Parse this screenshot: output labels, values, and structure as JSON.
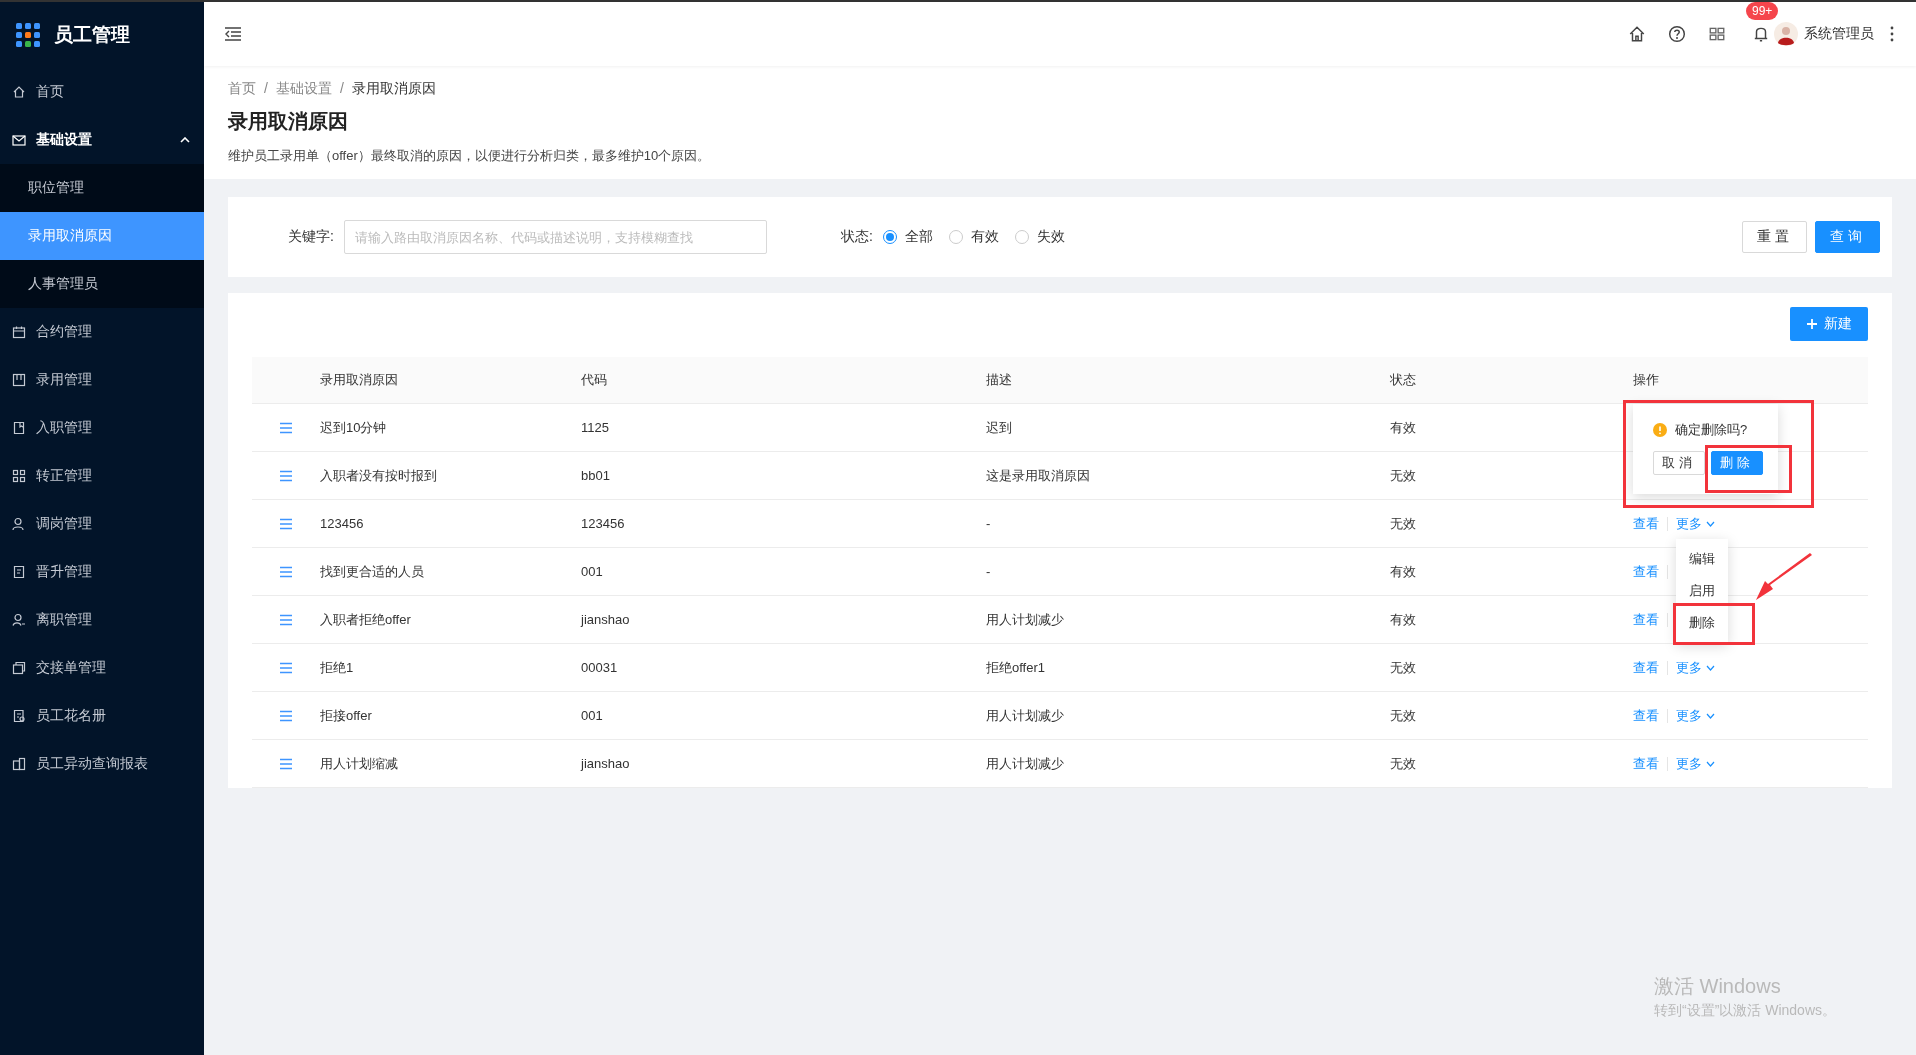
{
  "app": {
    "title": "员工管理"
  },
  "sidebar": {
    "items": [
      {
        "label": "首页"
      },
      {
        "label": "基础设置",
        "expanded": true,
        "children": [
          {
            "label": "职位管理",
            "selected": false
          },
          {
            "label": "录用取消原因",
            "selected": true
          },
          {
            "label": "人事管理员",
            "selected": false
          }
        ]
      },
      {
        "label": "合约管理"
      },
      {
        "label": "录用管理"
      },
      {
        "label": "入职管理"
      },
      {
        "label": "转正管理"
      },
      {
        "label": "调岗管理"
      },
      {
        "label": "晋升管理"
      },
      {
        "label": "离职管理"
      },
      {
        "label": "交接单管理"
      },
      {
        "label": "员工花名册"
      },
      {
        "label": "员工异动查询报表"
      }
    ]
  },
  "header": {
    "notification_badge": "99+",
    "user_name": "系统管理员"
  },
  "breadcrumb": {
    "separator": "/",
    "items": [
      "首页",
      "基础设置",
      "录用取消原因"
    ]
  },
  "page": {
    "title": "录用取消原因",
    "description": "维护员工录用单（offer）最终取消的原因，以便进行分析归类，最多维护10个原因。"
  },
  "filter": {
    "keyword_label": "关键字:",
    "keyword_placeholder": "请输入路由取消原因名称、代码或描述说明，支持模糊查找",
    "status_label": "状态:",
    "status_options": [
      {
        "label": "全部",
        "selected": true
      },
      {
        "label": "有效",
        "selected": false
      },
      {
        "label": "失效",
        "selected": false
      }
    ],
    "buttons": [
      {
        "label": "重置",
        "kind": "default"
      },
      {
        "label": "查询",
        "kind": "primary"
      }
    ]
  },
  "new_button": {
    "label": "新建"
  },
  "table": {
    "columns": [
      "录用取消原因",
      "代码",
      "描述",
      "状态",
      "操作"
    ],
    "rows": [
      {
        "reason": "迟到10分钟",
        "code": "1125",
        "description": "迟到",
        "status": "有效",
        "menu_open": false
      },
      {
        "reason": "入职者没有按时报到",
        "code": "bb01",
        "description": "这是录用取消原因",
        "status": "无效",
        "menu_open": false
      },
      {
        "reason": "123456",
        "code": "123456",
        "description": "-",
        "status": "无效",
        "menu_open": true,
        "actions": [
          {
            "label": "查看",
            "kind": "link"
          },
          {
            "label": "更多",
            "kind": "dropdown"
          }
        ]
      },
      {
        "reason": "找到更合适的人员",
        "code": "001",
        "description": "-",
        "status": "有效",
        "menu_open": false,
        "actions": [
          {
            "label": "查看",
            "kind": "link"
          }
        ]
      },
      {
        "reason": "入职者拒绝offer",
        "code": "jianshao",
        "description": "用人计划减少",
        "status": "有效",
        "menu_open": false,
        "actions": [
          {
            "label": "查看",
            "kind": "link"
          }
        ]
      },
      {
        "reason": "拒绝1",
        "code": "00031",
        "description": "拒绝offer1",
        "status": "无效",
        "menu_open": false,
        "actions": [
          {
            "label": "查看",
            "kind": "link"
          },
          {
            "label": "更多",
            "kind": "dropdown"
          }
        ]
      },
      {
        "reason": "拒接offer",
        "code": "001",
        "description": "用人计划减少",
        "status": "无效",
        "menu_open": false,
        "actions": [
          {
            "label": "查看",
            "kind": "link"
          },
          {
            "label": "更多",
            "kind": "dropdown"
          }
        ]
      },
      {
        "reason": "用人计划缩减",
        "code": "jianshao",
        "description": "用人计划减少",
        "status": "无效",
        "menu_open": false,
        "actions": [
          {
            "label": "查看",
            "kind": "link"
          },
          {
            "label": "更多",
            "kind": "dropdown"
          }
        ]
      }
    ]
  },
  "dropdown_menu": {
    "pointer_arrow": true,
    "items": [
      {
        "label": "编辑",
        "highlighted": false
      },
      {
        "label": "启用",
        "highlighted": false
      },
      {
        "label": "删除",
        "highlighted": true
      }
    ]
  },
  "popconfirm": {
    "highlighted": true,
    "message": "确定删除吗?",
    "buttons": [
      {
        "label": "取消",
        "kind": "default",
        "highlighted": false
      },
      {
        "label": "删除",
        "kind": "primary",
        "highlighted": true
      }
    ]
  },
  "os_notice": {
    "title": "激活 Windows",
    "text": "转到“设置”以激活 Windows。"
  }
}
